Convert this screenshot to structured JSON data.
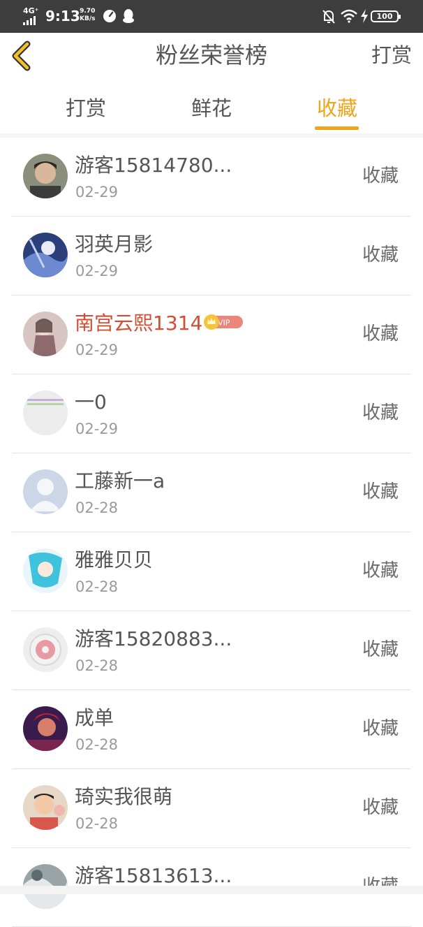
{
  "status_bar": {
    "network": "4G⁺",
    "time": "9:13",
    "speed_value": "9.70",
    "speed_unit": "KB/s",
    "battery": "100"
  },
  "header": {
    "title": "粉丝荣誉榜",
    "action": "打赏"
  },
  "tabs": [
    {
      "label": "打赏"
    },
    {
      "label": "鲜花"
    },
    {
      "label": "收藏"
    }
  ],
  "active_tab": "收藏",
  "accent_color": "#f0a31b",
  "vip_name_color": "#d44c32",
  "vip_badge_text": "VIP",
  "fans": [
    {
      "name": "游客15814780...",
      "date": "02-29",
      "action": "收藏"
    },
    {
      "name": "羽英月影",
      "date": "02-29",
      "action": "收藏"
    },
    {
      "name": "南宫云熙1314",
      "date": "02-29",
      "action": "收藏"
    },
    {
      "name": "一0",
      "date": "02-29",
      "action": "收藏"
    },
    {
      "name": "工藤新一a",
      "date": "02-28",
      "action": "收藏"
    },
    {
      "name": "雅雅贝贝",
      "date": "02-28",
      "action": "收藏"
    },
    {
      "name": "游客15820883...",
      "date": "02-28",
      "action": "收藏"
    },
    {
      "name": "成单",
      "date": "02-28",
      "action": "收藏"
    },
    {
      "name": "琦实我很萌",
      "date": "02-28",
      "action": "收藏"
    },
    {
      "name": "游客15813613...",
      "date": "",
      "action": "收藏"
    }
  ]
}
